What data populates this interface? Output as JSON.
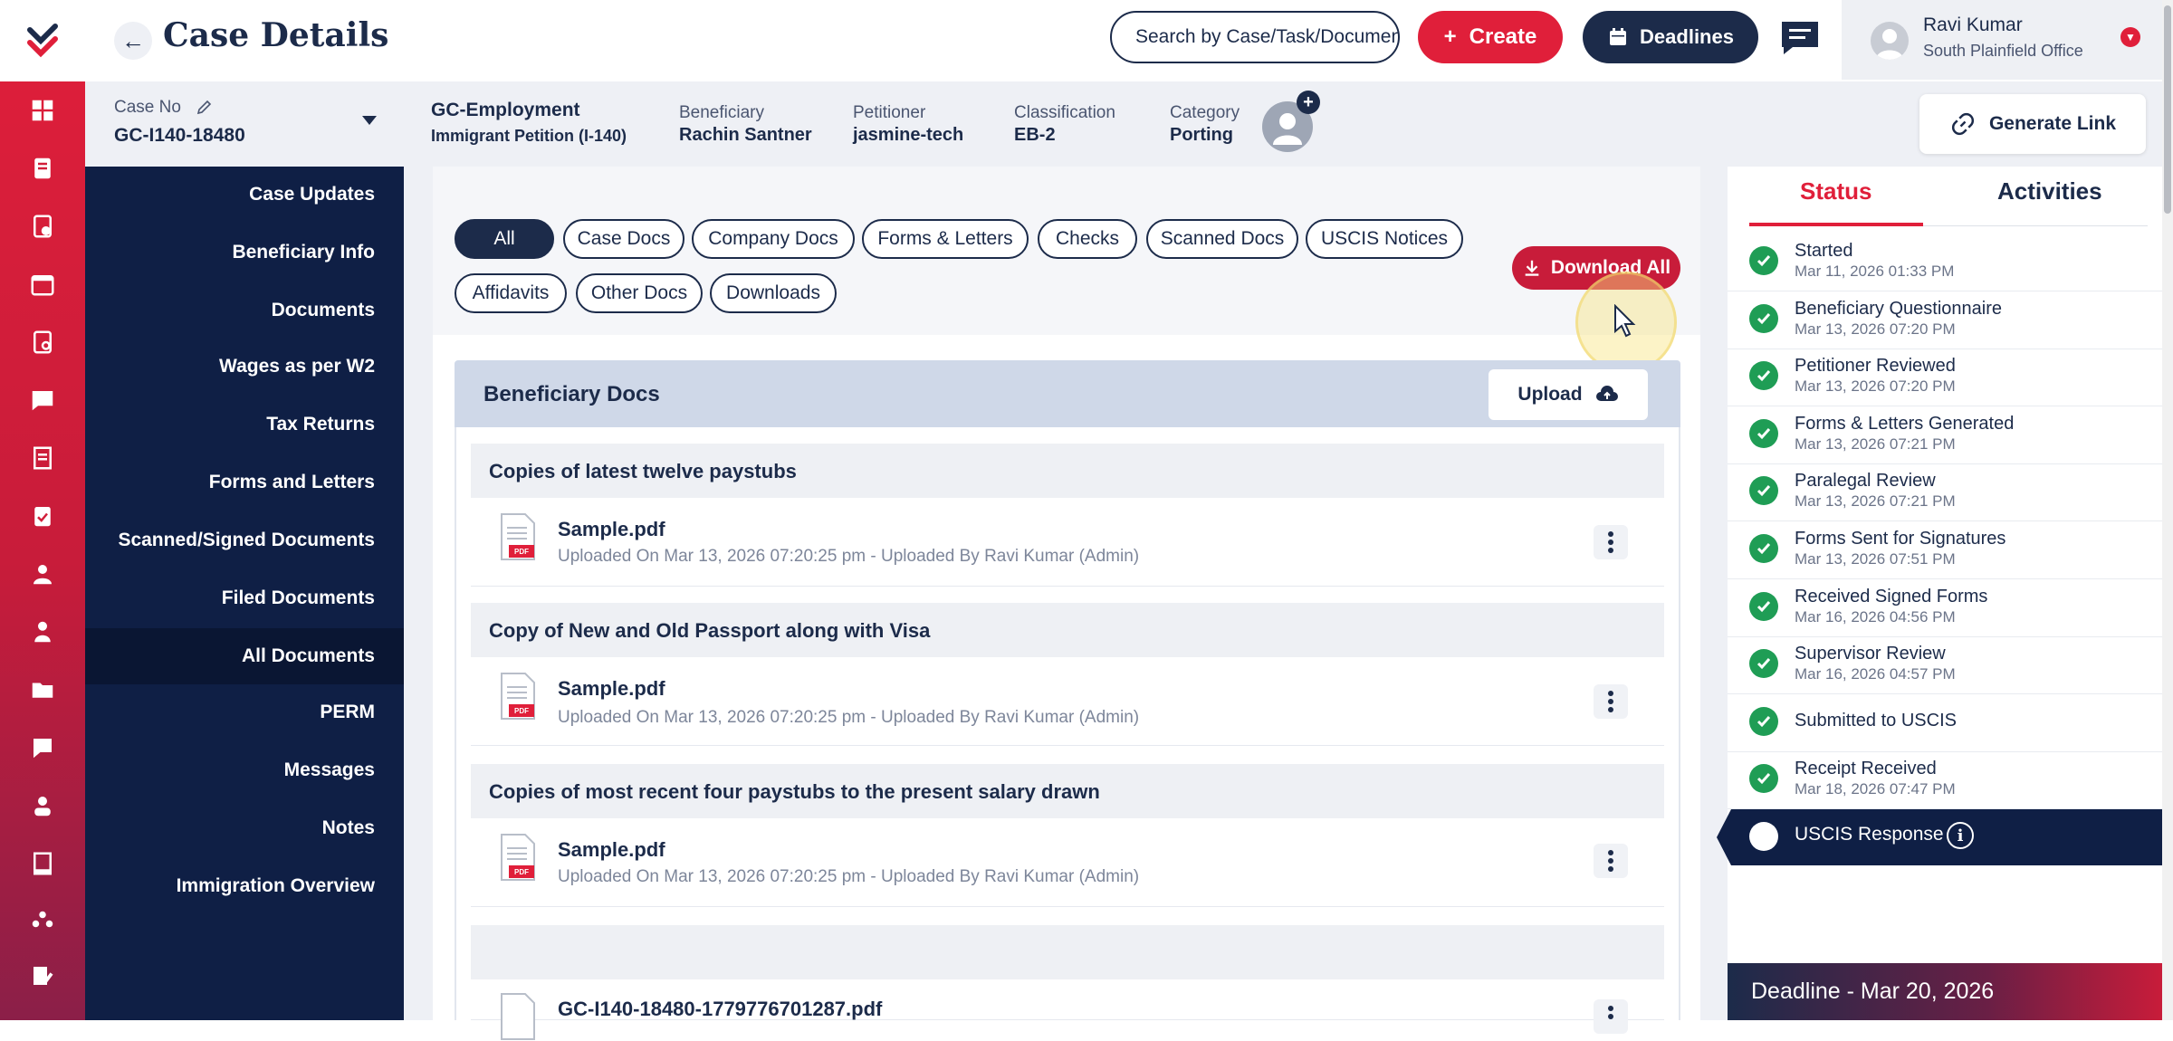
{
  "header": {
    "title": "Case Details",
    "search_placeholder": "Search by Case/Task/Document",
    "create_label": "Create",
    "deadlines_label": "Deadlines",
    "user_name": "Ravi Kumar",
    "user_office": "South Plainfield Office"
  },
  "case": {
    "case_no_label": "Case No",
    "case_no": "GC-I140-18480",
    "type": "GC-Employment",
    "subtype": "Immigrant Petition (I-140)",
    "beneficiary_label": "Beneficiary",
    "beneficiary": "Rachin Santner",
    "petitioner_label": "Petitioner",
    "petitioner": "jasmine-tech",
    "classification_label": "Classification",
    "classification": "EB-2",
    "category_label": "Category",
    "category": "Porting",
    "generate_link_label": "Generate Link"
  },
  "sidebar": {
    "items": [
      {
        "label": "Case Updates"
      },
      {
        "label": "Beneficiary Info"
      },
      {
        "label": "Documents"
      },
      {
        "label": "Wages as per W2"
      },
      {
        "label": "Tax Returns"
      },
      {
        "label": "Forms and Letters"
      },
      {
        "label": "Scanned/Signed Documents"
      },
      {
        "label": "Filed Documents"
      },
      {
        "label": "All Documents"
      },
      {
        "label": "PERM"
      },
      {
        "label": "Messages"
      },
      {
        "label": "Notes"
      },
      {
        "label": "Immigration Overview"
      }
    ],
    "active": "All Documents"
  },
  "filters": {
    "chips": [
      "All",
      "Case Docs",
      "Company Docs",
      "Forms & Letters",
      "Checks",
      "Scanned Docs",
      "USCIS Notices",
      "Affidavits",
      "Other Docs",
      "Downloads"
    ],
    "selected": "All",
    "download_all_label": "Download All"
  },
  "docs": {
    "section_title": "Beneficiary Docs",
    "upload_label": "Upload",
    "pdf_tag": "PDF",
    "groups": [
      {
        "title": "Copies of latest twelve paystubs",
        "file": "Sample.pdf",
        "meta": "Uploaded On Mar 13, 2026 07:20:25 pm - Uploaded By Ravi Kumar (Admin)"
      },
      {
        "title": "Copy of New and Old Passport along with Visa",
        "file": "Sample.pdf",
        "meta": "Uploaded On Mar 13, 2026 07:20:25 pm - Uploaded By Ravi Kumar (Admin)"
      },
      {
        "title": "Copies of most recent four paystubs to the present salary drawn",
        "file": "Sample.pdf",
        "meta": "Uploaded On Mar 13, 2026 07:20:25 pm - Uploaded By Ravi Kumar (Admin)"
      },
      {
        "title": "",
        "file": "GC-I140-18480-1779776701287.pdf",
        "meta": ""
      }
    ]
  },
  "status_panel": {
    "tabs": [
      "Status",
      "Activities"
    ],
    "active_tab": "Status",
    "steps": [
      {
        "title": "Started",
        "date": "Mar 11, 2026 01:33 PM"
      },
      {
        "title": "Beneficiary Questionnaire",
        "date": "Mar 13, 2026 07:20 PM"
      },
      {
        "title": "Petitioner Reviewed",
        "date": "Mar 13, 2026 07:20 PM"
      },
      {
        "title": "Forms & Letters Generated",
        "date": "Mar 13, 2026 07:21 PM"
      },
      {
        "title": "Paralegal Review",
        "date": "Mar 13, 2026 07:21 PM"
      },
      {
        "title": "Forms Sent for Signatures",
        "date": "Mar 13, 2026 07:51 PM"
      },
      {
        "title": "Received Signed Forms",
        "date": "Mar 16, 2026 04:56 PM"
      },
      {
        "title": "Supervisor Review",
        "date": "Mar 16, 2026 04:57 PM"
      },
      {
        "title": "Submitted to USCIS",
        "date": ""
      },
      {
        "title": "Receipt Received",
        "date": "Mar 18, 2026 07:47 PM"
      }
    ],
    "current_step": "USCIS Response",
    "deadline": "Deadline - Mar 20, 2026"
  },
  "colors": {
    "brand_red": "#e01f3a",
    "navy": "#0f1f45",
    "success_green": "#1f9d55"
  }
}
